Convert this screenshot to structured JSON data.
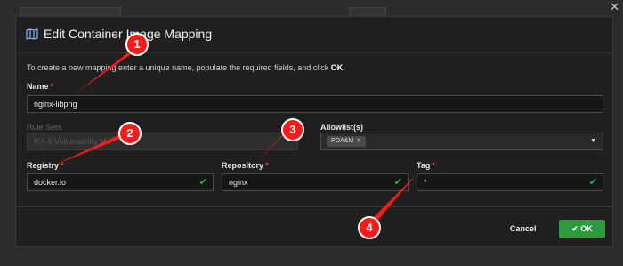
{
  "modal": {
    "title": "Edit Container Image Mapping",
    "instructions_pre": "To create a new mapping enter a unique name, populate the required fields, and click ",
    "instructions_ok": "OK",
    "instructions_post": "."
  },
  "fields": {
    "name": {
      "label": "Name",
      "value": "nginx-libpng"
    },
    "rule_sets": {
      "label": "Rule Sets",
      "value": "RX-5 Vulnerability Ma..."
    },
    "allowlists": {
      "label": "Allowlist(s)",
      "chip": "POA&M"
    },
    "registry": {
      "label": "Registry",
      "value": "docker.io"
    },
    "repository": {
      "label": "Repository",
      "value": "nginx"
    },
    "tag": {
      "label": "Tag",
      "value": "*"
    }
  },
  "buttons": {
    "cancel": "Cancel",
    "ok": "OK"
  },
  "annotations": [
    "1",
    "2",
    "3",
    "4"
  ],
  "colors": {
    "accent_green": "#2b9b3e",
    "annotation_red": "#ff1a1a",
    "required_red": "#e3443b"
  },
  "icons": [
    "map-icon",
    "check-icon",
    "chevron-down-icon",
    "close-icon"
  ]
}
